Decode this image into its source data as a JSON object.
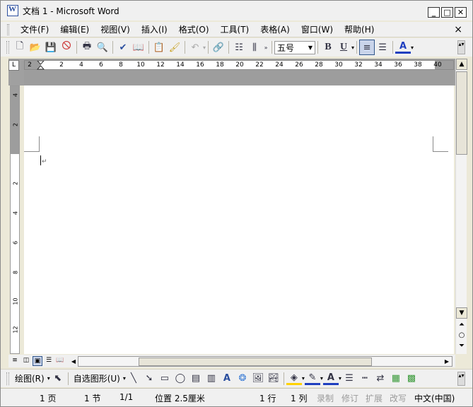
{
  "window": {
    "title": "文档 1 - Microsoft Word"
  },
  "menubar": {
    "items": [
      "文件(F)",
      "编辑(E)",
      "视图(V)",
      "插入(I)",
      "格式(O)",
      "工具(T)",
      "表格(A)",
      "窗口(W)",
      "帮助(H)"
    ],
    "close": "×"
  },
  "toolbar": {
    "font_size": "五号",
    "bold": "B",
    "underline": "U",
    "font_color": "A"
  },
  "ruler": {
    "marks": [
      "2",
      "2",
      "4",
      "6",
      "8",
      "10",
      "12",
      "14",
      "16",
      "18",
      "20",
      "22",
      "24",
      "26",
      "28",
      "30",
      "32",
      "34",
      "36",
      "38",
      "40"
    ],
    "vmarks": [
      "4",
      "2",
      "2",
      "4",
      "6",
      "8",
      "10",
      "12"
    ]
  },
  "drawing": {
    "draw_label": "绘图(R)",
    "autoshapes_label": "自选图形(U)"
  },
  "statusbar": {
    "page": "1 页",
    "section": "1 节",
    "page_of": "1/1",
    "position": "位置 2.5厘米",
    "line": "1 行",
    "col": "1 列",
    "rec": "录制",
    "trk": "修订",
    "ext": "扩展",
    "ovr": "改写",
    "lang": "中文(中国)"
  }
}
